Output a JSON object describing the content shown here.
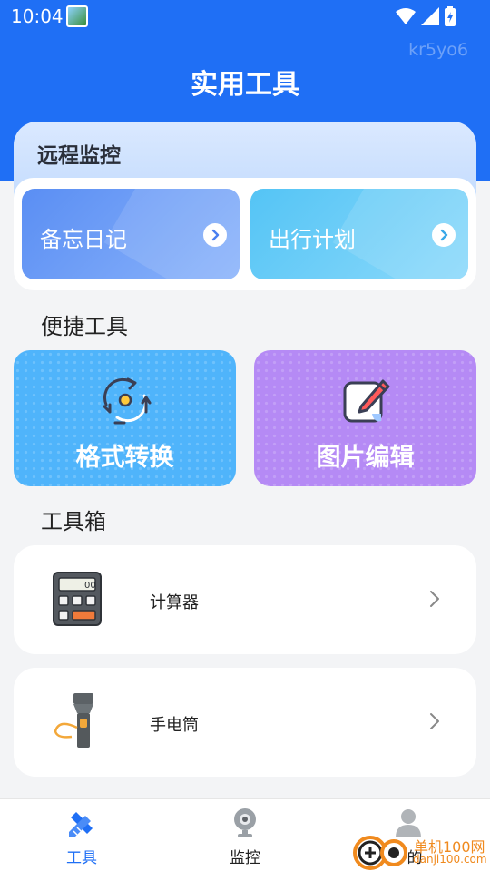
{
  "status_bar": {
    "time": "10:04"
  },
  "watermark_text": "kr5yo6",
  "header": {
    "title": "实用工具"
  },
  "monitor": {
    "title": "远程监控",
    "cards": [
      {
        "label": "备忘日记"
      },
      {
        "label": "出行计划"
      }
    ]
  },
  "quick_tools": {
    "title": "便捷工具",
    "items": [
      {
        "label": "格式转换",
        "icon": "convert-icon"
      },
      {
        "label": "图片编辑",
        "icon": "edit-image-icon"
      }
    ]
  },
  "toolbox": {
    "title": "工具箱",
    "items": [
      {
        "label": "计算器",
        "icon": "calculator-icon"
      },
      {
        "label": "手电筒",
        "icon": "flashlight-icon"
      }
    ]
  },
  "bottom_nav": {
    "items": [
      {
        "label": "工具",
        "active": true
      },
      {
        "label": "监控",
        "active": false
      },
      {
        "label": "的",
        "active": false
      }
    ]
  },
  "site_watermark": {
    "line1": "单机100网",
    "line2": "danji100.com"
  },
  "colors": {
    "primary": "#1f6ff5",
    "quick_blue": "#4fb4fb",
    "quick_purple": "#b58af5",
    "accent_orange": "#f08a1e"
  }
}
